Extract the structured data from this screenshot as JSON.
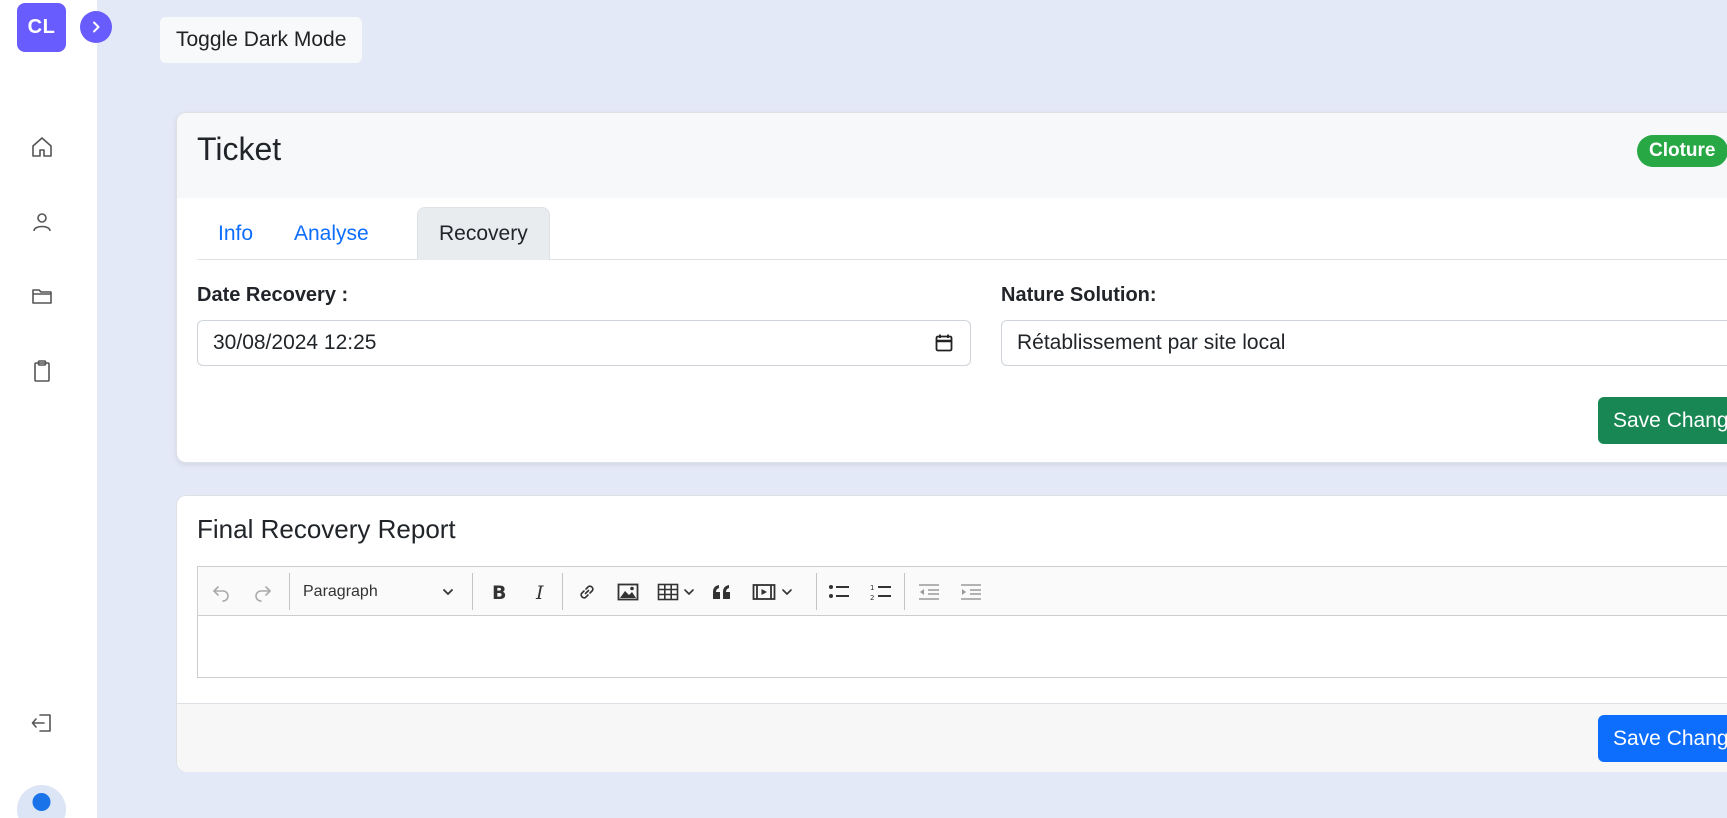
{
  "sidebar": {
    "logo_text": "CL",
    "nav_icons": [
      "home-icon",
      "user-icon",
      "folder-icon",
      "clipboard-icon"
    ],
    "logout_icon": "logout-icon"
  },
  "header": {
    "dark_mode_button": "Toggle Dark Mode"
  },
  "ticket": {
    "title": "Ticket",
    "status_badge": "Cloture",
    "tabs": [
      {
        "label": "Info",
        "active": false
      },
      {
        "label": "Analyse",
        "active": false
      },
      {
        "label": "Recovery",
        "active": true
      }
    ],
    "date_recovery": {
      "label": "Date Recovery :",
      "value": "30/08/2024 12:25"
    },
    "nature_solution": {
      "label": "Nature Solution:",
      "value": "Rétablissement par site local"
    },
    "save_button": "Save Changes"
  },
  "report": {
    "title": "Final Recovery Report",
    "block_style": "Paragraph",
    "content": "",
    "save_button": "Save Changes"
  },
  "colors": {
    "accent": "#695cfe",
    "badge_green": "#28a745",
    "save_green": "#198754",
    "save_blue": "#0d6efd",
    "background": "#e4e9f7"
  }
}
